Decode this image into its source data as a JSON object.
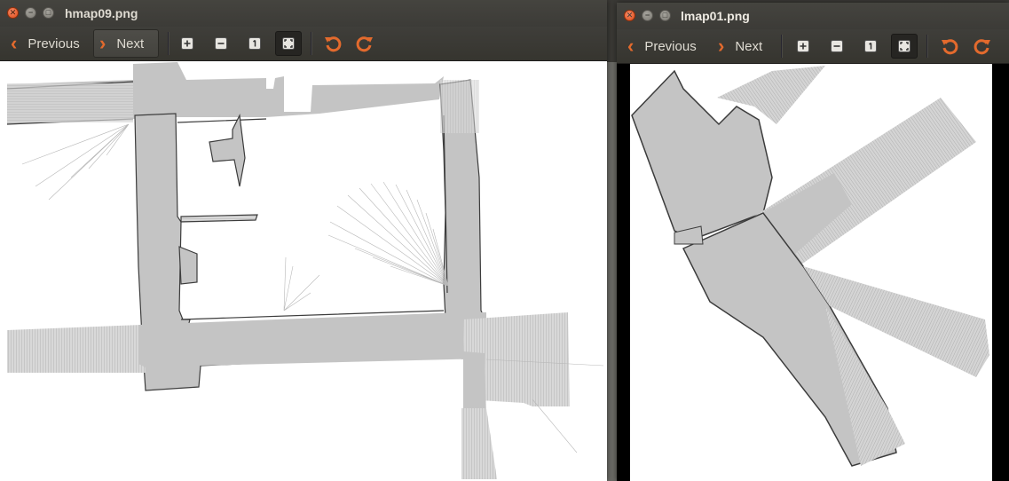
{
  "left_window": {
    "title": "hmap09.png",
    "previous_label": "Previous",
    "next_label": "Next"
  },
  "right_window": {
    "title": "lmap01.png",
    "previous_label": "Previous",
    "next_label": "Next"
  },
  "colors": {
    "map_free": "#c4c4c4",
    "map_wall": "#3c3c3c",
    "toolbar_accent": "#e36a2d",
    "titlebar": "#3c3b37"
  }
}
